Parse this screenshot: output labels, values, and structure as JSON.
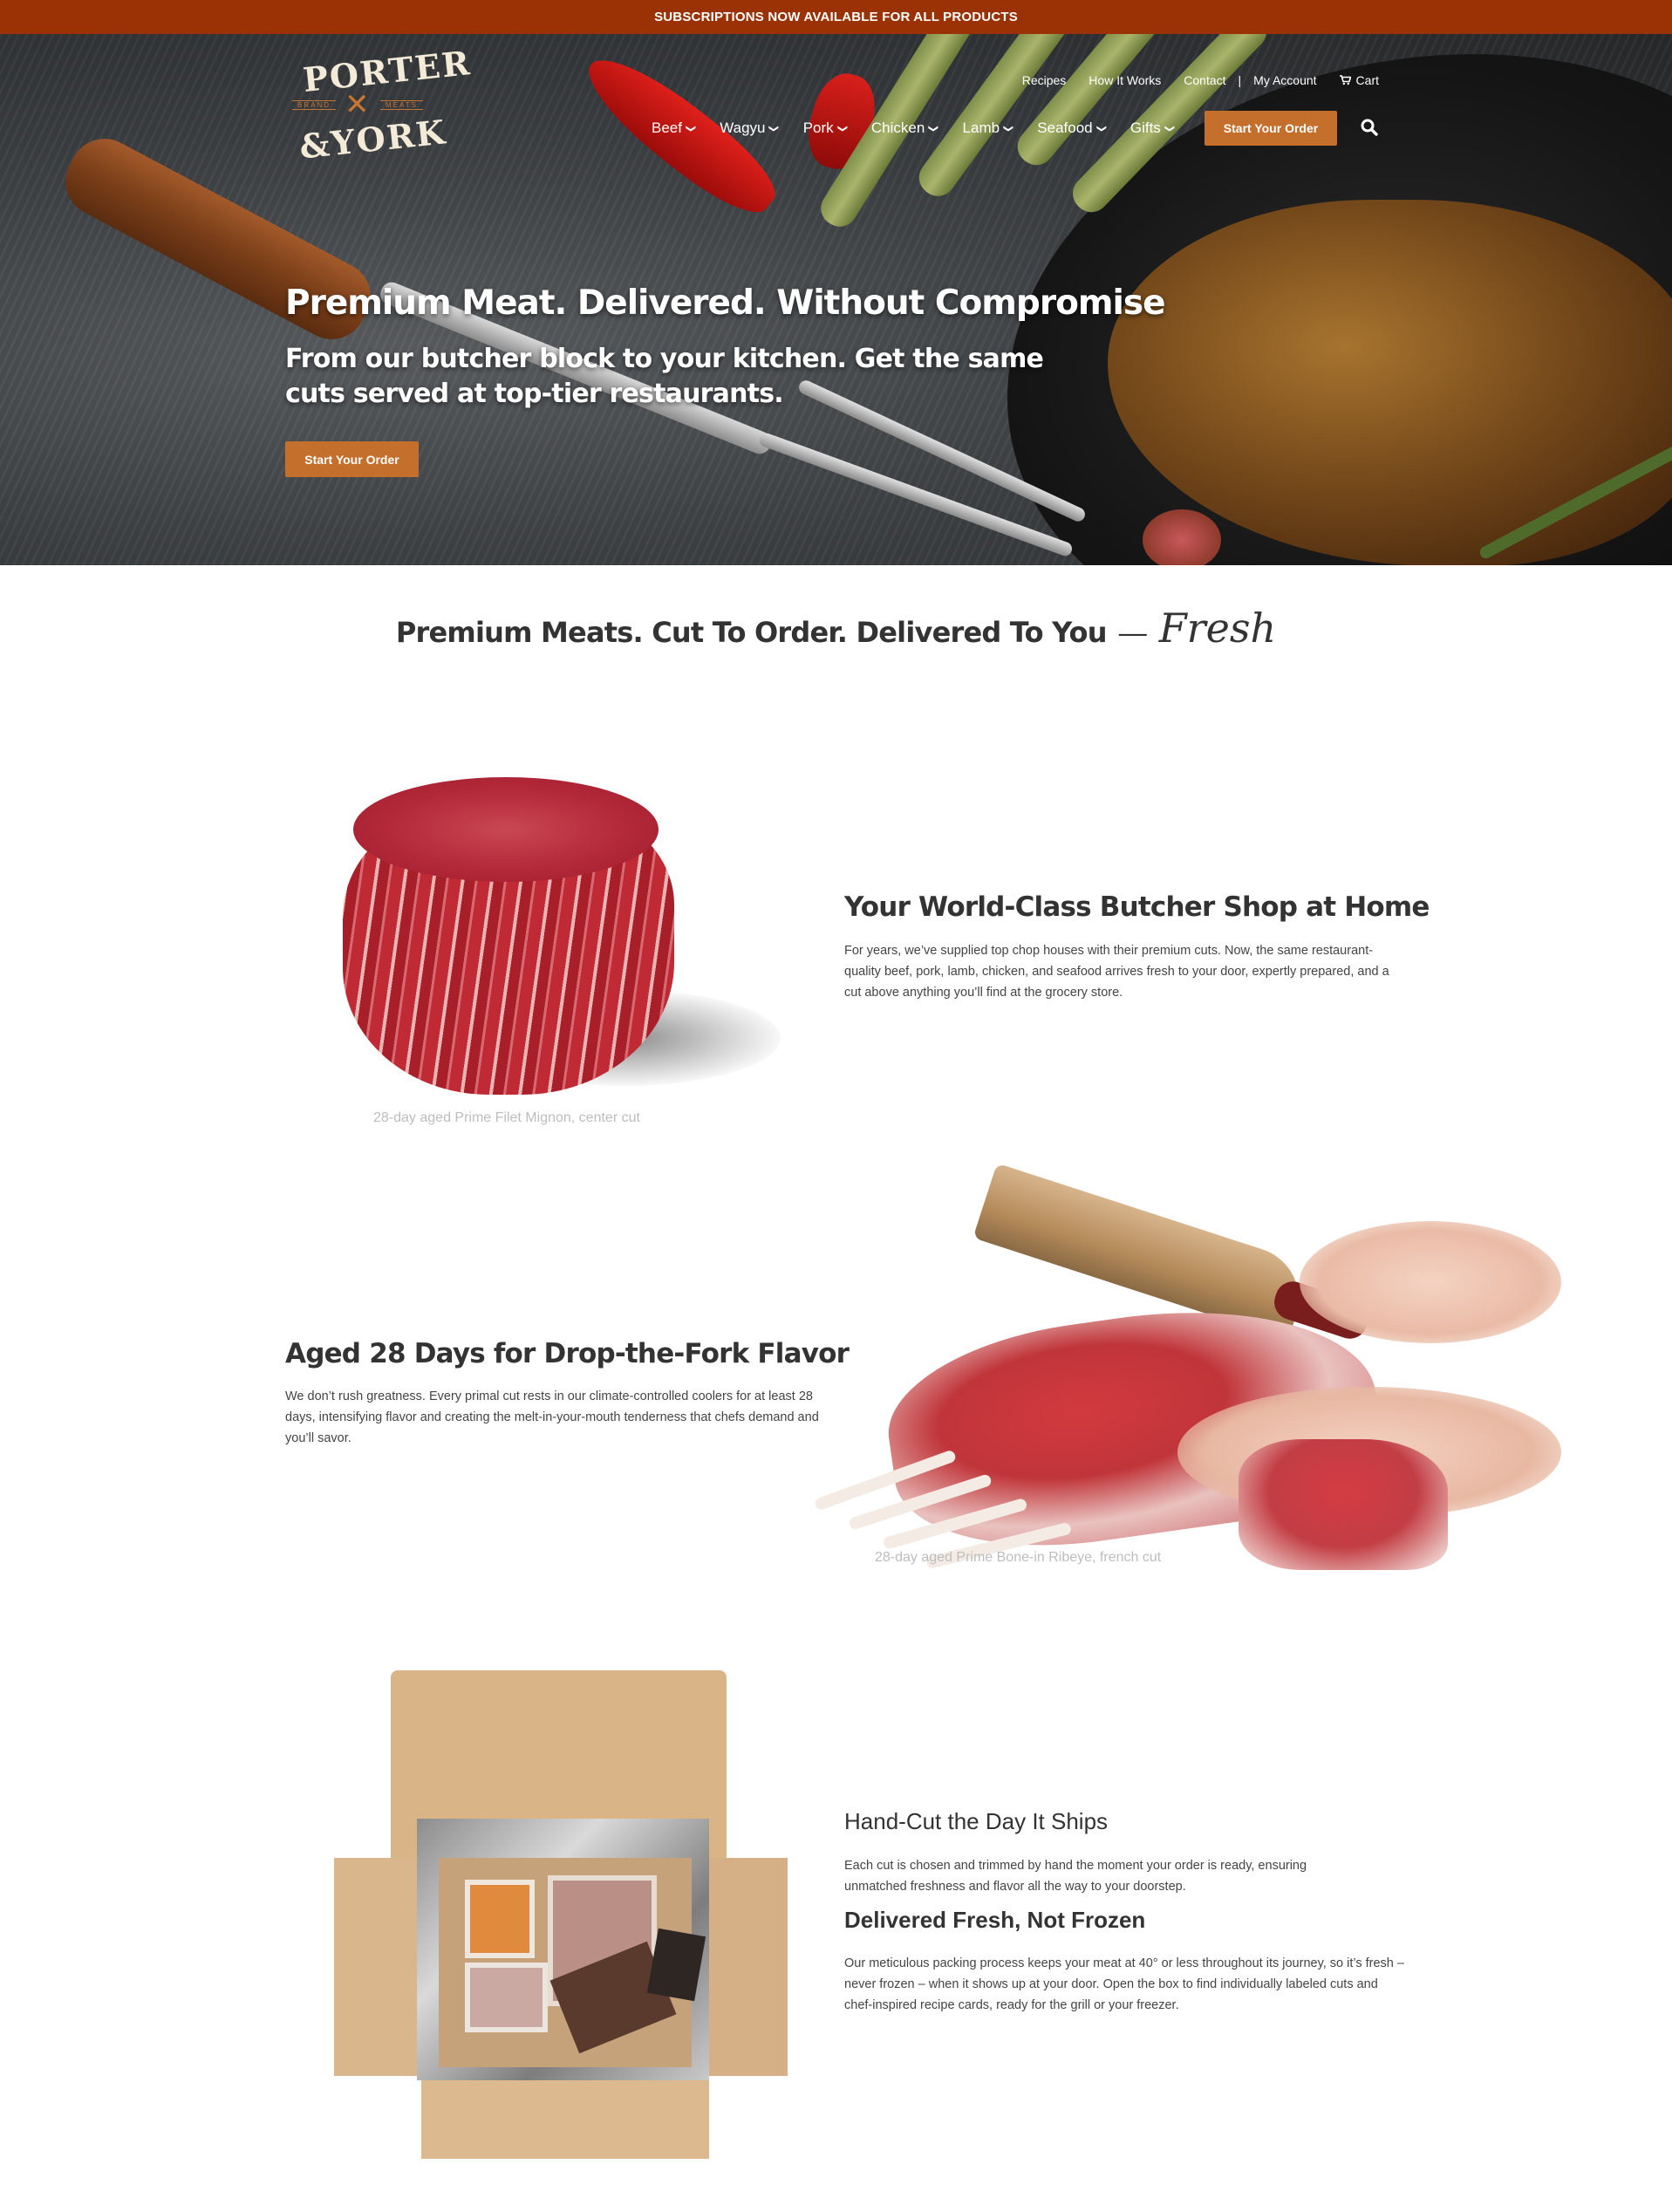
{
  "announcement": {
    "text": "SUBSCRIPTIONS NOW AVAILABLE FOR ALL PRODUCTS"
  },
  "brand": {
    "line1": "PORTER",
    "line2": "&YORK",
    "left_tag": "BRAND",
    "right_tag": "MEATS",
    "accent_color": "#c46f2c",
    "bar_color": "#9a3206"
  },
  "utility_nav": {
    "items": [
      "Recipes",
      "How It Works",
      "Contact",
      "My Account"
    ],
    "separator": "|",
    "cart_label": "Cart",
    "cart_icon": "cart-icon"
  },
  "main_nav": {
    "items": [
      "Beef",
      "Wagyu",
      "Pork",
      "Chicken",
      "Lamb",
      "Seafood",
      "Gifts"
    ],
    "cta_label": "Start Your Order",
    "search_icon": "search-icon"
  },
  "hero": {
    "headline": "Premium Meat. Delivered. Without Compromise",
    "subheadline": "From our butcher block to your kitchen. Get the same cuts served at top-tier restaurants.",
    "cta_label": "Start Your Order"
  },
  "tagline": {
    "main": "Premium Meats. Cut To Order. Delivered To You",
    "dash": "—",
    "script": "Fresh"
  },
  "section1": {
    "title": "Your World-Class Butcher Shop at Home",
    "body": "For years, we’ve supplied top chop houses with their premium cuts. Now, the same restaurant-quality beef, pork, lamb, chicken, and seafood arrives fresh to your door, expertly prepared, and a cut above anything you’ll find at the grocery store.",
    "caption": "28-day aged Prime Filet Mignon, center cut"
  },
  "section2": {
    "title": "Aged 28 Days for Drop-the-Fork Flavor",
    "body": "We don’t rush greatness. Every primal cut rests in our climate-controlled coolers for at least 28 days, intensifying flavor and creating the melt-in-your-mouth tenderness that chefs demand and you’ll savor.",
    "caption": "28-day aged Prime Bone-in Ribeye, french cut"
  },
  "section3": {
    "title_a": "Hand-Cut the Day It Ships",
    "body_a": "Each cut is chosen and trimmed by hand the moment your order is ready, ensuring unmatched freshness and flavor all the way to your doorstep.",
    "title_b": "Delivered Fresh, Not Frozen",
    "body_b": "Our meticulous packing process keeps your meat at 40° or less throughout its journey, so it’s fresh – never frozen – when it shows up at your door. Open the box to find individually labeled cuts and chef-inspired recipe cards, ready for the grill or your freezer."
  }
}
